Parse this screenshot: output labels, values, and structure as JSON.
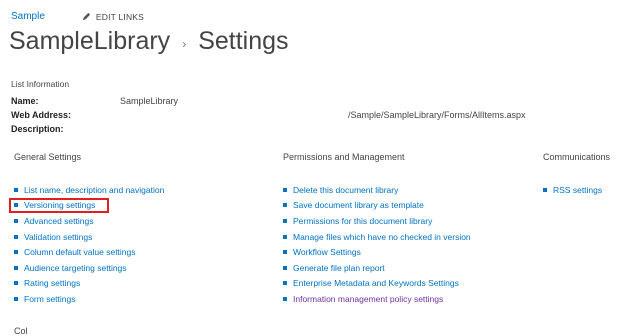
{
  "topbar": {
    "site_link": "Sample",
    "edit_links": "EDIT LINKS"
  },
  "title": {
    "library": "SampleLibrary",
    "separator": "›",
    "page": "Settings"
  },
  "list_info": {
    "heading": "List Information",
    "name_label": "Name:",
    "name_value": "SampleLibrary",
    "web_label": "Web Address:",
    "web_value": "/Sample/SampleLibrary/Forms/AllItems.aspx",
    "desc_label": "Description:"
  },
  "general": {
    "heading": "General Settings",
    "items": [
      "List name, description and navigation",
      "Versioning settings",
      "Advanced settings",
      "Validation settings",
      "Column default value settings",
      "Audience targeting settings",
      "Rating settings",
      "Form settings"
    ]
  },
  "permissions": {
    "heading": "Permissions and Management",
    "items": [
      "Delete this document library",
      "Save document library as template",
      "Permissions for this document library",
      "Manage files which have no checked in version",
      "Workflow Settings",
      "Generate file plan report",
      "Enterprise Metadata and Keywords Settings",
      "Information management policy settings"
    ]
  },
  "communications": {
    "heading": "Communications",
    "items": [
      "RSS settings"
    ]
  },
  "bottom_partial": "Col",
  "colors": {
    "link": "#0072c6",
    "visited": "#7030a0",
    "highlight": "#f3f31b",
    "callout": "#e02020"
  }
}
